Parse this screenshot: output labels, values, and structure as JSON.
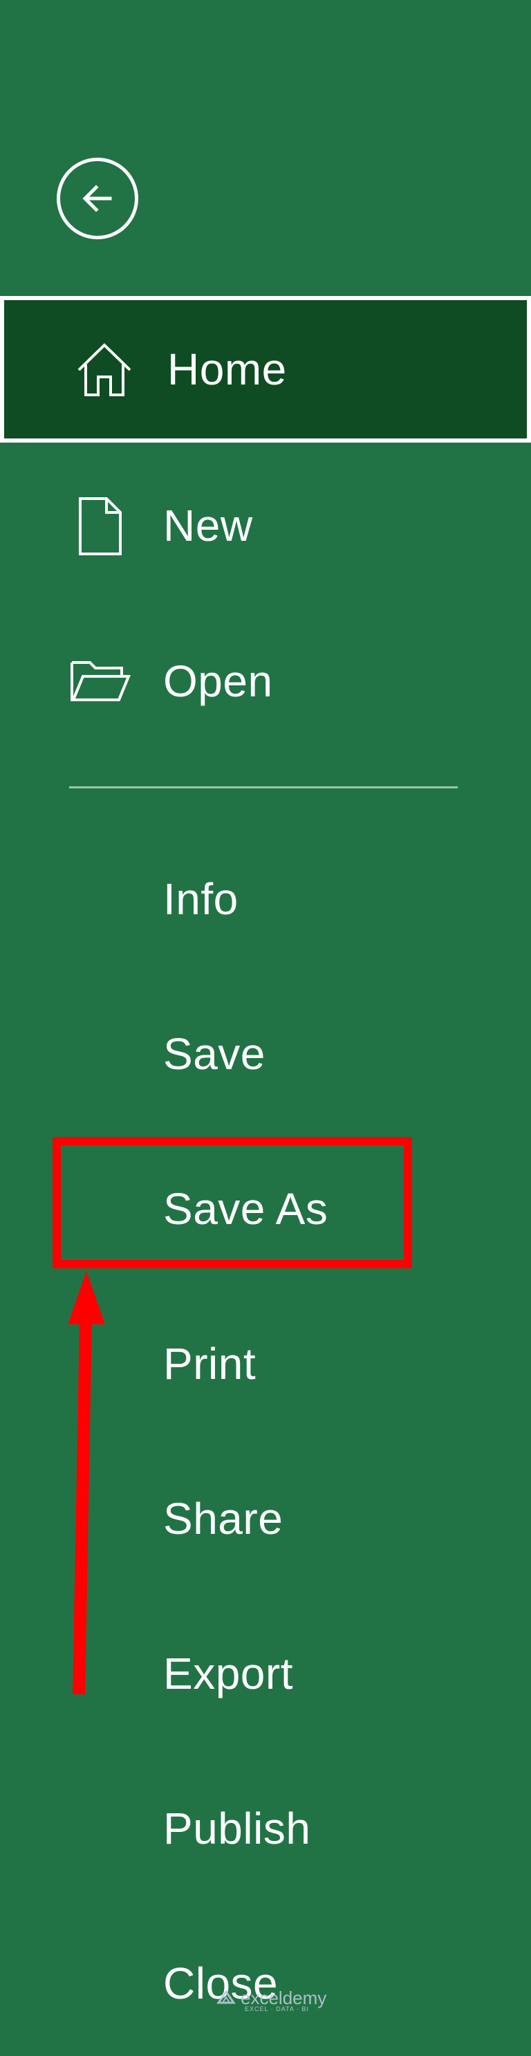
{
  "backstage": {
    "back_button": {
      "icon": "back-arrow-icon"
    },
    "primary_items": [
      {
        "label": "Home",
        "icon": "home-icon",
        "active": true
      },
      {
        "label": "New",
        "icon": "new-document-icon"
      },
      {
        "label": "Open",
        "icon": "open-folder-icon"
      }
    ],
    "secondary_items": [
      {
        "label": "Info"
      },
      {
        "label": "Save"
      },
      {
        "label": "Save As",
        "highlighted": true
      },
      {
        "label": "Print"
      },
      {
        "label": "Share"
      },
      {
        "label": "Export"
      },
      {
        "label": "Publish"
      },
      {
        "label": "Close"
      }
    ]
  },
  "annotation": {
    "highlight_color": "#ff0000",
    "highlighted_item": "Save As"
  },
  "watermark": {
    "name": "exceldemy",
    "tagline": "EXCEL · DATA · BI"
  },
  "colors": {
    "background": "#217346",
    "active_background": "#004b1c",
    "text": "#ffffff",
    "divider": "#9cc7ab"
  }
}
